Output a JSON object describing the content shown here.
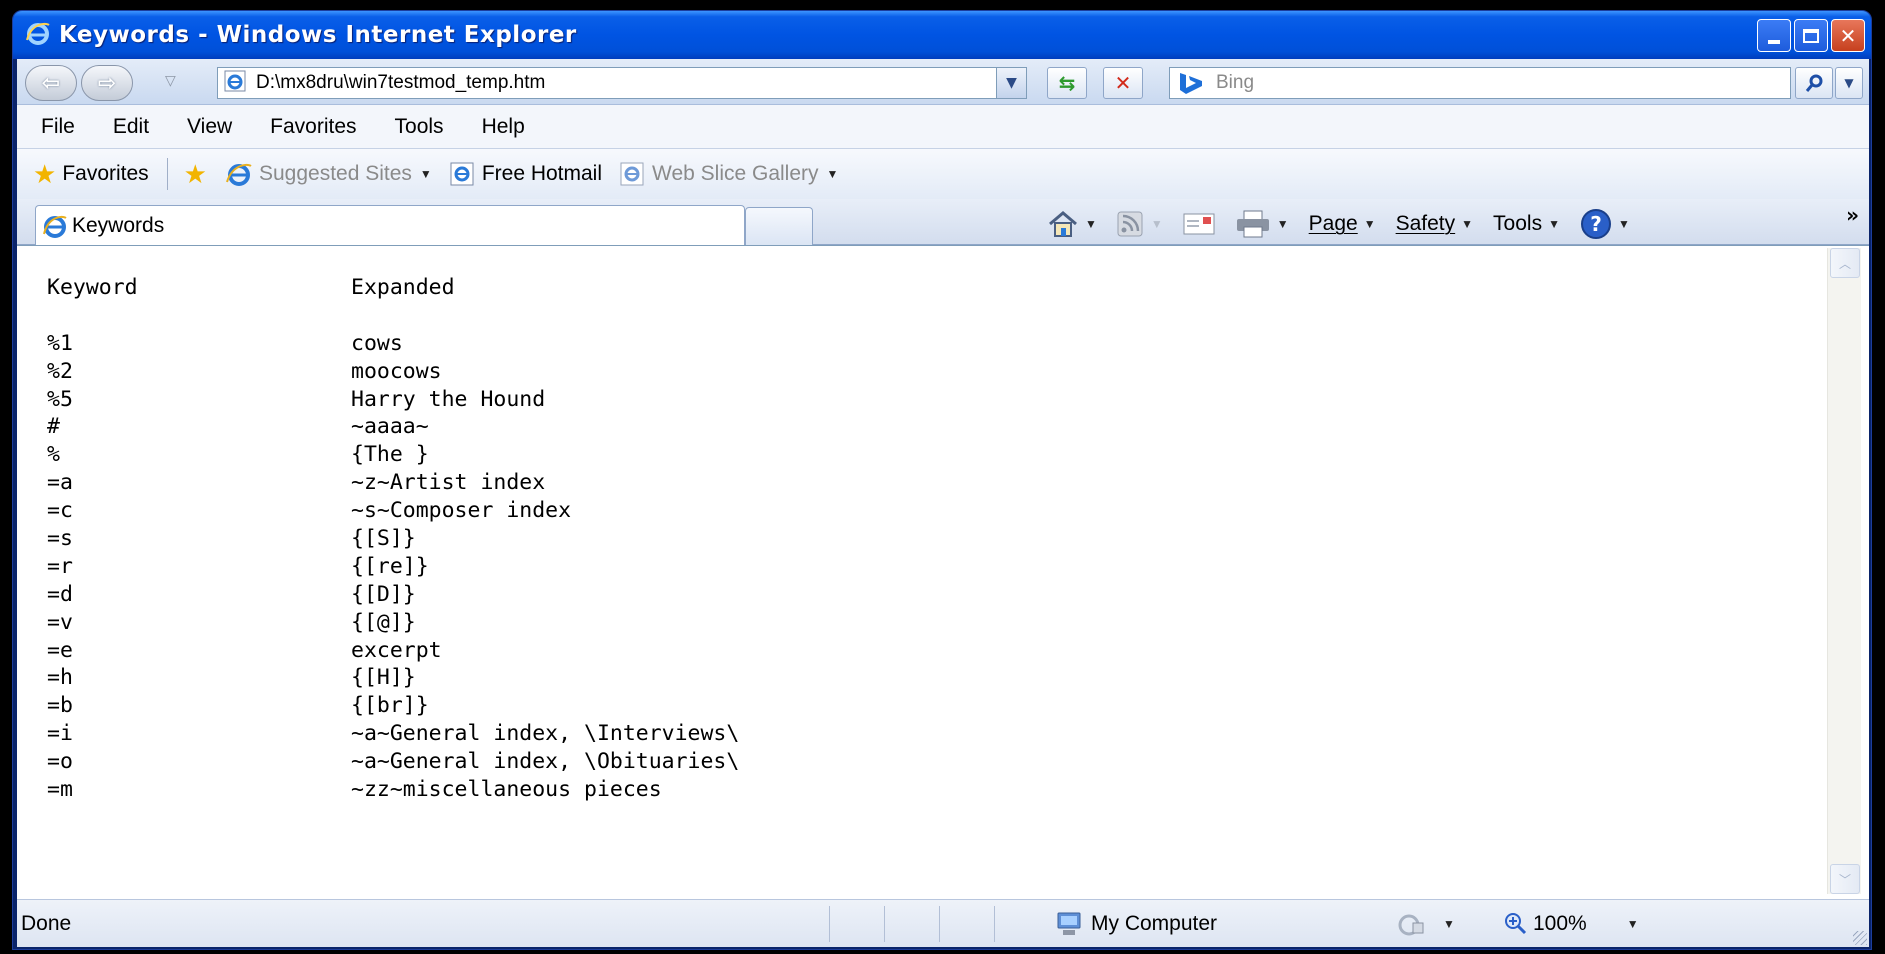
{
  "window": {
    "title": "Keywords - Windows Internet Explorer"
  },
  "address_bar": {
    "url": "D:\\mx8dru\\win7testmod_temp.htm",
    "search_placeholder": "Bing"
  },
  "menu": {
    "items": [
      "File",
      "Edit",
      "View",
      "Favorites",
      "Tools",
      "Help"
    ]
  },
  "favorites_bar": {
    "favorites_label": "Favorites",
    "items": [
      "Suggested Sites",
      "Free Hotmail",
      "Web Slice Gallery"
    ]
  },
  "tabs": {
    "active_label": "Keywords"
  },
  "command_bar": {
    "page_label": "Page",
    "safety_label": "Safety",
    "tools_label": "Tools"
  },
  "content": {
    "header": {
      "keyword": "Keyword",
      "expanded": "Expanded"
    },
    "rows": [
      {
        "keyword": "%1",
        "expanded": "cows"
      },
      {
        "keyword": "%2",
        "expanded": "moocows"
      },
      {
        "keyword": "%5",
        "expanded": "Harry the Hound"
      },
      {
        "keyword": "#",
        "expanded": "~aaaa~"
      },
      {
        "keyword": "%",
        "expanded": "{The }"
      },
      {
        "keyword": "=a",
        "expanded": "~z~Artist index"
      },
      {
        "keyword": "=c",
        "expanded": "~s~Composer index"
      },
      {
        "keyword": "=s",
        "expanded": "{[S]}"
      },
      {
        "keyword": "=r",
        "expanded": "{[re]}"
      },
      {
        "keyword": "=d",
        "expanded": "{[D]}"
      },
      {
        "keyword": "=v",
        "expanded": "{[@]}"
      },
      {
        "keyword": "=e",
        "expanded": "excerpt"
      },
      {
        "keyword": "=h",
        "expanded": "{[H]}"
      },
      {
        "keyword": "=b",
        "expanded": "{[br]}"
      },
      {
        "keyword": "=i",
        "expanded": "~a~General index, \\Interviews\\"
      },
      {
        "keyword": "=o",
        "expanded": "~a~General index, \\Obituaries\\"
      },
      {
        "keyword": "=m",
        "expanded": "~zz~miscellaneous pieces"
      }
    ]
  },
  "status_bar": {
    "status": "Done",
    "zone": "My Computer",
    "zoom": "100%"
  },
  "colors": {
    "title_bar": "#0054e3",
    "chrome": "#eef3fb",
    "close_button": "#c6401e"
  }
}
